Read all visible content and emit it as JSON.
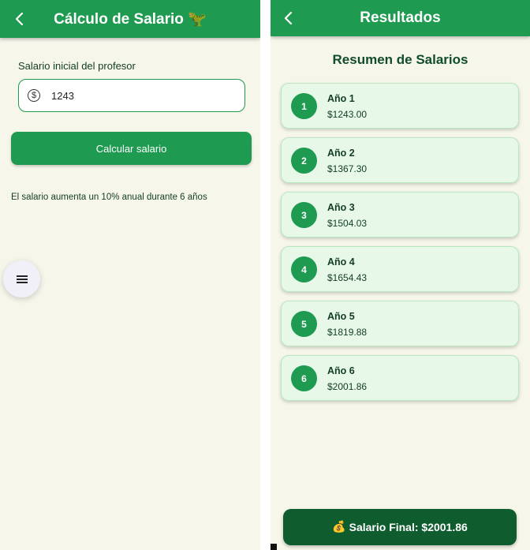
{
  "calculator": {
    "title": "Cálculo de Salario 🦖",
    "back_icon": "back-arrow-icon",
    "input_label": "Salario inicial del profesor",
    "input_value": "1243",
    "input_icon": "dollar-circle-icon",
    "button_label": "Calcular salario",
    "info": "El salario aumenta un 10% anual durante 6 años",
    "fab_icon": "menu-icon"
  },
  "results": {
    "title": "Resultados",
    "back_icon": "back-arrow-icon",
    "heading": "Resumen de Salarios",
    "items": [
      {
        "number": "1",
        "year": "Año 1",
        "amount": "$1243.00"
      },
      {
        "number": "2",
        "year": "Año 2",
        "amount": "$1367.30"
      },
      {
        "number": "3",
        "year": "Año 3",
        "amount": "$1504.03"
      },
      {
        "number": "4",
        "year": "Año 4",
        "amount": "$1654.43"
      },
      {
        "number": "5",
        "year": "Año 5",
        "amount": "$1819.88"
      },
      {
        "number": "6",
        "year": "Año 6",
        "amount": "$2001.86"
      }
    ],
    "final_icon": "money-bag-icon",
    "final_label": "Salario Final: $2001.86"
  },
  "colors": {
    "primary": "#1f9a51",
    "dark_primary": "#0f5c2e",
    "background": "#f6f6ea",
    "card": "#e7f8e8"
  }
}
